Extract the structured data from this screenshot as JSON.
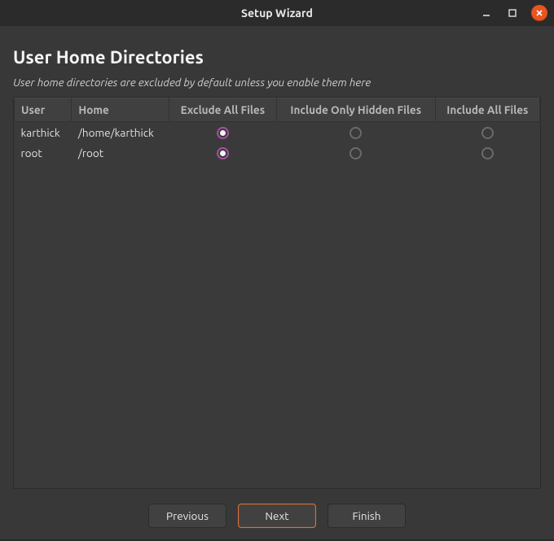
{
  "window": {
    "title": "Setup Wizard"
  },
  "page": {
    "title": "User Home Directories",
    "subtitle": "User home directories are excluded by default unless you enable them here"
  },
  "columns": {
    "user": "User",
    "home": "Home",
    "exclude": "Exclude All Files",
    "hidden": "Include Only Hidden Files",
    "include": "Include All Files"
  },
  "rows": [
    {
      "user": "karthick",
      "home": "/home/karthick",
      "choice": "exclude"
    },
    {
      "user": "root",
      "home": "/root",
      "choice": "exclude"
    }
  ],
  "buttons": {
    "previous": "Previous",
    "next": "Next",
    "finish": "Finish"
  }
}
